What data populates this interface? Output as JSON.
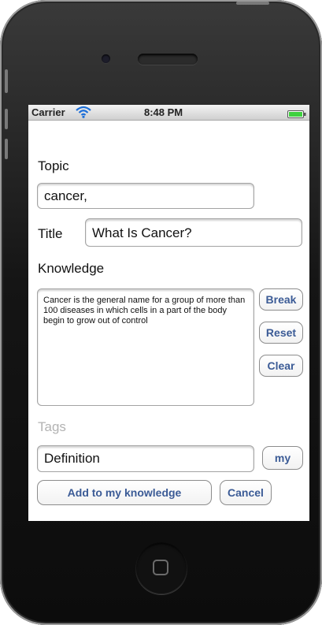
{
  "status_bar": {
    "carrier": "Carrier",
    "time": "8:48 PM",
    "icons": [
      "wifi-icon",
      "battery-icon"
    ]
  },
  "form": {
    "topic_label": "Topic",
    "topic_value": "cancer,",
    "title_label": "Title",
    "title_value": "What Is Cancer?",
    "knowledge_label": "Knowledge",
    "knowledge_text": "Cancer is the general name for a group of more than 100 diseases in which cells   in a part of the body begin to grow out of control",
    "tags_label": "Tags",
    "tags_value": "Definition"
  },
  "buttons": {
    "break": "Break",
    "reset": "Reset",
    "clear": "Clear",
    "my": "my",
    "add": "Add to my knowledge",
    "cancel": "Cancel"
  },
  "colors": {
    "button_text": "#3b5b96",
    "battery": "#3fd13f",
    "wifi": "#1d6fd8"
  }
}
